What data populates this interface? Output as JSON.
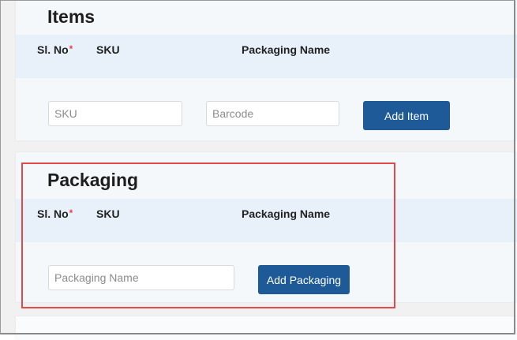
{
  "items_section": {
    "title": "Items",
    "columns": {
      "sl_no": "Sl. No",
      "required_mark": "*",
      "sku": "SKU",
      "packaging_name": "Packaging Name"
    },
    "sku_placeholder": "SKU",
    "barcode_placeholder": "Barcode",
    "add_button": "Add Item"
  },
  "packaging_section": {
    "title": "Packaging",
    "columns": {
      "sl_no": "Sl. No",
      "required_mark": "*",
      "sku": "SKU",
      "packaging_name": "Packaging Name"
    },
    "name_placeholder": "Packaging Name",
    "add_button": "Add Packaging"
  },
  "colors": {
    "primary_button": "#1d5a97",
    "required": "#e04444",
    "highlight": "#e04a4a",
    "header_bg": "#e8f1fa"
  }
}
